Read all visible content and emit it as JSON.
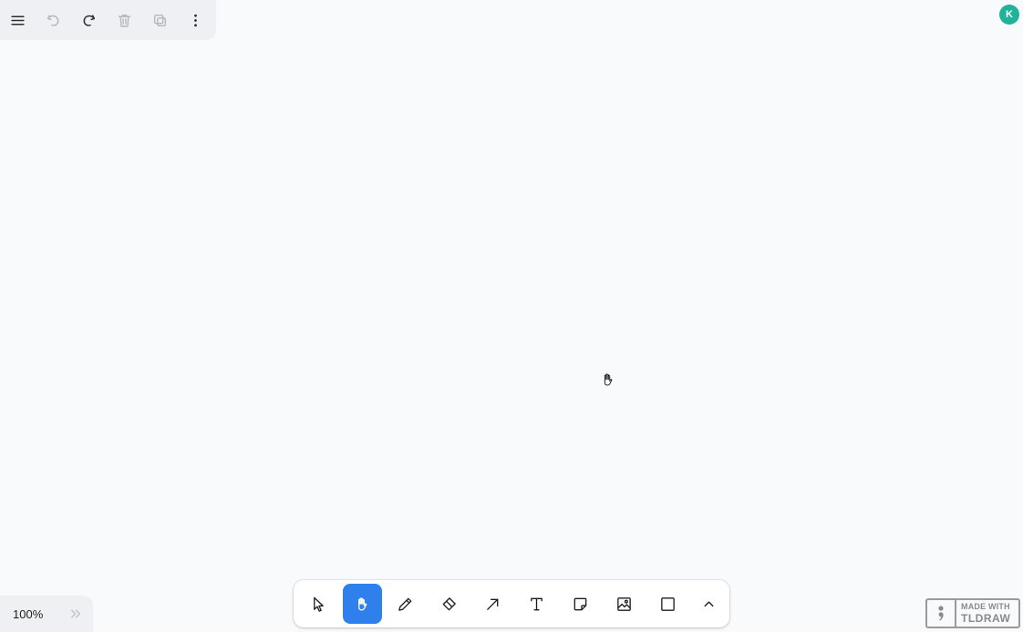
{
  "menu": {
    "items": [
      {
        "name": "main-menu-button",
        "icon": "hamburger-icon",
        "enabled": true
      },
      {
        "name": "undo-button",
        "icon": "undo-icon",
        "enabled": false
      },
      {
        "name": "redo-button",
        "icon": "redo-icon",
        "enabled": true
      },
      {
        "name": "delete-button",
        "icon": "trash-icon",
        "enabled": false
      },
      {
        "name": "duplicate-button",
        "icon": "duplicate-icon",
        "enabled": false
      },
      {
        "name": "more-actions-button",
        "icon": "dots-vertical-icon",
        "enabled": true
      }
    ]
  },
  "user": {
    "initial": "K",
    "color": "#1fb39a"
  },
  "toolbar": {
    "active_tool": "hand",
    "accent_color": "#2f80ed",
    "tools": [
      {
        "id": "select",
        "icon": "pointer-icon"
      },
      {
        "id": "hand",
        "icon": "hand-icon"
      },
      {
        "id": "draw",
        "icon": "pencil-icon"
      },
      {
        "id": "eraser",
        "icon": "eraser-icon"
      },
      {
        "id": "arrow",
        "icon": "arrow-icon"
      },
      {
        "id": "text",
        "icon": "text-icon"
      },
      {
        "id": "note",
        "icon": "sticky-note-icon"
      },
      {
        "id": "asset",
        "icon": "image-icon"
      },
      {
        "id": "rectangle",
        "icon": "rectangle-icon"
      },
      {
        "id": "more",
        "icon": "chevron-up-icon"
      }
    ]
  },
  "zoom": {
    "label": "100%"
  },
  "badge": {
    "line1": "MADE WITH",
    "line2": "TLDRAW"
  }
}
